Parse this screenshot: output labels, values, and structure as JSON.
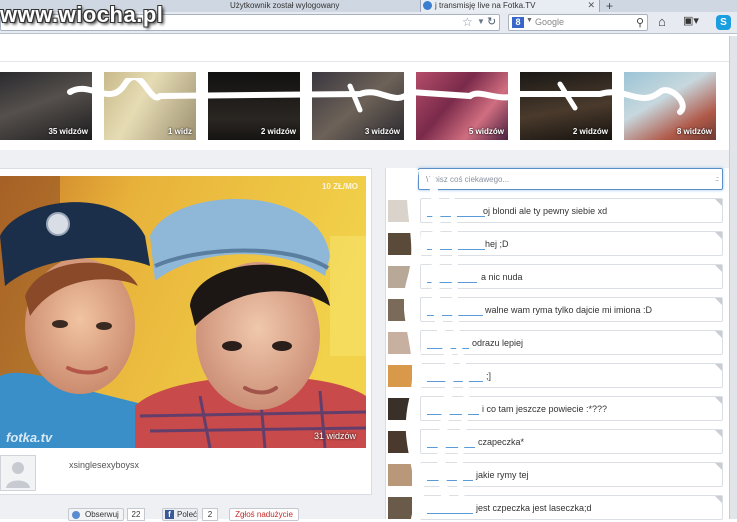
{
  "browser": {
    "tabs": [
      {
        "label": "Użytkownik został wylogowany"
      },
      {
        "label": "j transmisję live na Fotka.TV"
      }
    ],
    "new_tab": "+",
    "search": {
      "engine_letter": "8",
      "placeholder": "Google"
    }
  },
  "watermark": "www.wiocha.pl",
  "thumbnails": [
    {
      "count": "35 widzów"
    },
    {
      "count": "1 widz"
    },
    {
      "count": "2 widzów"
    },
    {
      "count": "3 widzów"
    },
    {
      "count": "5 widzów"
    },
    {
      "count": "2 widzów"
    },
    {
      "count": "8 widzów"
    }
  ],
  "video": {
    "logo": "fotka.tv",
    "viewers": "31 widzów",
    "live_badge": "10 ZŁ/MO"
  },
  "profile": {
    "username": "xsinglesexyboysx"
  },
  "actions": {
    "observe_label": "Obserwuj",
    "observe_count": "22",
    "fb_label": "Poleć",
    "fb_count": "2",
    "report_label": "Zgłoś nadużycie"
  },
  "chat": {
    "input_placeholder": "Wpisz coś ciekawego...",
    "messages": [
      {
        "text": "oj blondi ale ty pewny siebie xd"
      },
      {
        "text": "hej ;D"
      },
      {
        "text": "a nic nuda"
      },
      {
        "text": "walne wam ryma tylko dajcie mi imiona :D"
      },
      {
        "text": "odrazu lepiej"
      },
      {
        "text": ";]"
      },
      {
        "text": "i co tam jeszcze powiecie :*???"
      },
      {
        "text": "czapeczka*"
      },
      {
        "text": "jakie rymy tej"
      },
      {
        "text": "jest czpeczka jest laseczka;d"
      }
    ]
  }
}
